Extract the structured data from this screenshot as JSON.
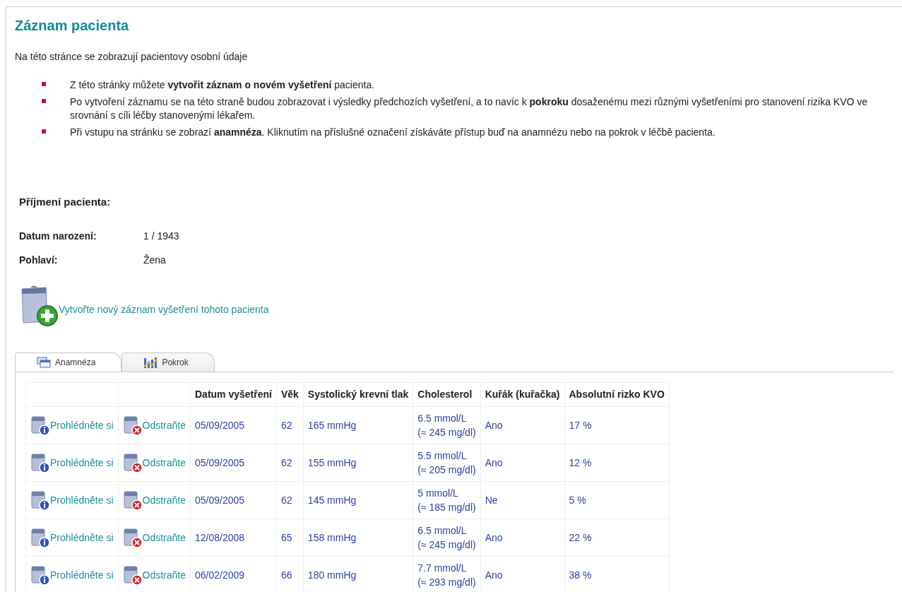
{
  "title": "Záznam pacienta",
  "intro": "Na této stránce se zobrazují pacientovy osobní údaje",
  "bullets": [
    "Z této stránky můžete **vytvořit záznam o novém vyšetření** pacienta.",
    "Po vytvoření záznamu se na této straně budou zobrazovat i výsledky předchozích vyšetření, a to navíc k **pokroku** dosaženému mezi různými vyšetřeními pro stanovení rizika KVO ve srovnání s cíli léčby stanovenými lékařem.",
    "Při vstupu na stránku se zobrazí **anamnéza**. Kliknutím na příslušné označení získáváte přístup buď na anamnézu nebo na pokrok v léčbě pacienta."
  ],
  "patient": {
    "surname_label": "Příjmení pacienta:",
    "fields": [
      {
        "label": "Datum narození:",
        "value": "1 / 1943"
      },
      {
        "label": "Pohlaví:",
        "value": "Žena"
      }
    ]
  },
  "new_record_link": "Vytvořte nový záznam vyšetření tohoto pacienta",
  "tabs": [
    {
      "label": "Anamnéza",
      "kind": "list",
      "selected": true
    },
    {
      "label": "Pokrok",
      "kind": "chart",
      "selected": false
    }
  ],
  "table": {
    "columns": [
      "Datum vyšetření",
      "Věk",
      "Systolický krevní tlak",
      "Cholesterol",
      "Kuřák (kuřačka)",
      "Absolutní rizko KVO"
    ],
    "rows": [
      {
        "view": "Prohlédněte si",
        "delete": "Odstraňte",
        "date": "05/09/2005",
        "age": "62",
        "bp": "165 mmHg",
        "cholesterol": [
          "6.5 mmol/L",
          "(≈ 245 mg/dl)"
        ],
        "smoker": "Ano",
        "risk": "17 %"
      },
      {
        "view": "Prohlédněte si",
        "delete": "Odstraňte",
        "date": "05/09/2005",
        "age": "62",
        "bp": "155 mmHg",
        "cholesterol": [
          "5.5 mmol/L",
          "(≈ 205 mg/dl)"
        ],
        "smoker": "Ano",
        "risk": "12 %"
      },
      {
        "view": "Prohlédněte si",
        "delete": "Odstraňte",
        "date": "05/09/2005",
        "age": "62",
        "bp": "145 mmHg",
        "cholesterol": [
          "5 mmol/L",
          "(≈ 185 mg/dl)"
        ],
        "smoker": "Ne",
        "risk": "5 %"
      },
      {
        "view": "Prohlédněte si",
        "delete": "Odstraňte",
        "date": "12/08/2008",
        "age": "65",
        "bp": "158 mmHg",
        "cholesterol": [
          "6.5 mmol/L",
          "(≈ 245 mg/dl)"
        ],
        "smoker": "Ano",
        "risk": "22 %"
      },
      {
        "view": "Prohlédněte si",
        "delete": "Odstraňte",
        "date": "06/02/2009",
        "age": "66",
        "bp": "180 mmHg",
        "cholesterol": [
          "7.7 mmol/L",
          "(≈ 293 mg/dl)"
        ],
        "smoker": "Ano",
        "risk": "38 %"
      }
    ]
  }
}
